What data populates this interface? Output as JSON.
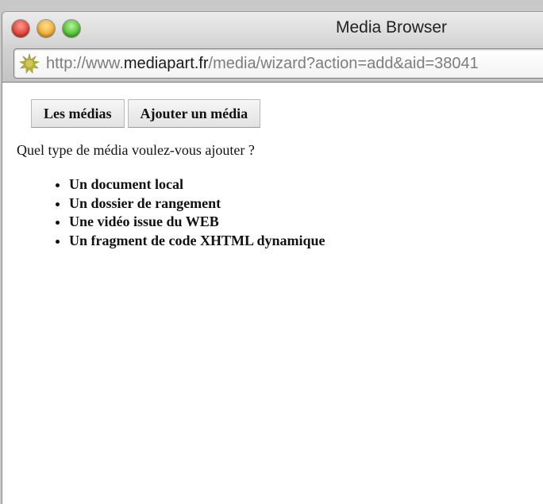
{
  "window": {
    "title": "Media Browser"
  },
  "address_bar": {
    "url_prefix": "http://www.",
    "url_domain": "mediapart.fr",
    "url_path": "/media/wizard?action=add&aid=38041"
  },
  "tabs": [
    {
      "label": "Les médias"
    },
    {
      "label": "Ajouter un média"
    }
  ],
  "page": {
    "question": "Quel type de média voulez-vous ajouter ?",
    "choices": [
      {
        "label": "Un document local"
      },
      {
        "label": "Un dossier de rangement"
      },
      {
        "label": "Une vidéo issue du WEB"
      },
      {
        "label": "Un fragment de code XHTML dynamique"
      }
    ]
  },
  "colors": {
    "close": "#e2483c",
    "minimize": "#f2b03a",
    "zoom": "#58c63b",
    "site_icon": "#b8b23a"
  },
  "icons": {
    "site": "starburst-favicon-icon"
  }
}
